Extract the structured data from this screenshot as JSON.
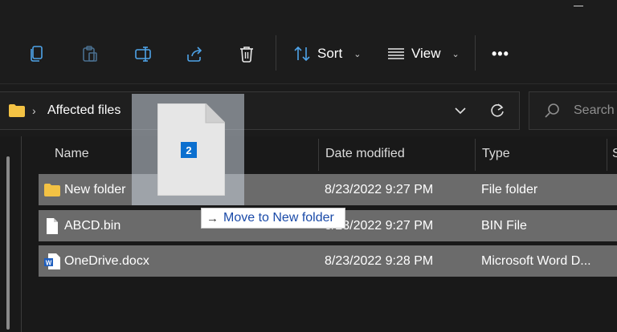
{
  "toolbar": {
    "sort_label": "Sort",
    "view_label": "View",
    "more_label": "•••"
  },
  "address": {
    "folder_name": "Affected files",
    "search_placeholder": "Search A"
  },
  "columns": {
    "name": "Name",
    "date": "Date modified",
    "type": "Type",
    "size": "S"
  },
  "files": [
    {
      "name": "New folder",
      "date": "8/23/2022 9:27 PM",
      "type": "File folder",
      "icon": "folder-icon"
    },
    {
      "name": "ABCD.bin",
      "date": "8/23/2022 9:27 PM",
      "type": "BIN File",
      "icon": "file-icon"
    },
    {
      "name": "OneDrive.docx",
      "date": "8/23/2022 9:28 PM",
      "type": "Microsoft Word D...",
      "icon": "word-doc-icon"
    }
  ],
  "drag": {
    "count": "2",
    "tooltip": "Move to New folder"
  },
  "colors": {
    "background": "#1b1b1b",
    "row_selected": "#6b6b6b",
    "folder_yellow": "#f3c244",
    "accent_blue": "#0b6fcf"
  }
}
